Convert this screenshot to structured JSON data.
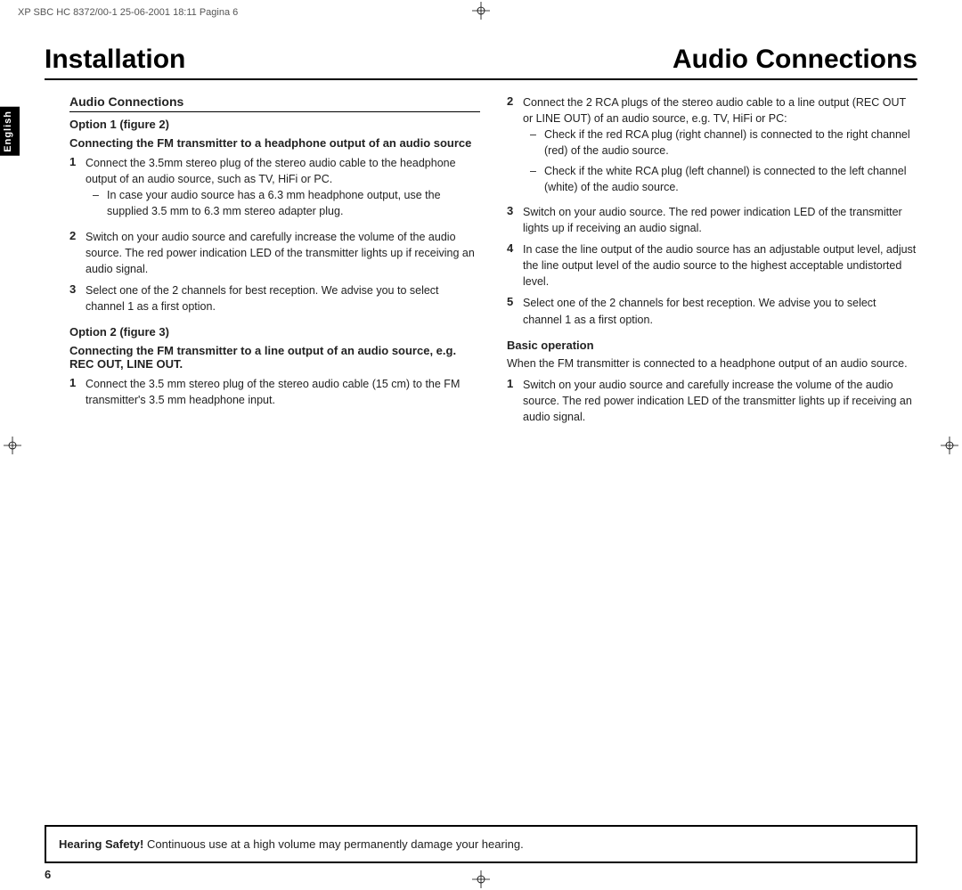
{
  "doc_header": {
    "text": "XP SBC HC 8372/00-1   25-06-2001  18:11   Pagina  6"
  },
  "titles": {
    "installation": "Installation",
    "audio_connections": "Audio Connections"
  },
  "tab": {
    "label": "English"
  },
  "left_column": {
    "section_heading": "Audio Connections",
    "option1_heading": "Option 1 (figure 2)",
    "connecting_heading": "Connecting the FM transmitter to a headphone output of an audio source",
    "items": [
      {
        "num": "1",
        "text": "Connect the 3.5mm stereo plug of the stereo audio cable to the headphone output of an audio source, such as TV, HiFi or PC.",
        "bullets": [
          "In case your audio source has a 6.3 mm headphone output, use the supplied 3.5 mm to 6.3 mm stereo adapter plug."
        ]
      },
      {
        "num": "2",
        "text": "Switch on your audio source and carefully increase the volume of the audio source. The red power indication LED of the transmitter lights up if receiving an audio signal.",
        "bullets": []
      },
      {
        "num": "3",
        "text": "Select one of the 2 channels for best reception. We advise you to select channel 1 as a first option.",
        "bullets": []
      }
    ],
    "option2_heading": "Option 2 (figure 3)",
    "connecting2_heading": "Connecting the FM transmitter to a line output of an audio source, e.g. REC OUT, LINE OUT.",
    "items2": [
      {
        "num": "1",
        "text": "Connect the 3.5 mm stereo plug of the stereo audio cable (15 cm) to the FM transmitter's 3.5 mm headphone input.",
        "bullets": []
      }
    ]
  },
  "right_column": {
    "step2_intro": "2",
    "step2_text": "Connect the 2 RCA plugs of the stereo audio cable to a line output (REC OUT or LINE OUT) of an audio source, e.g. TV, HiFi or PC:",
    "step2_bullets": [
      "Check if the red RCA plug (right channel) is connected to the right channel (red) of the audio source.",
      "Check if the white RCA plug (left channel) is connected to the left channel (white) of the audio source."
    ],
    "step3_num": "3",
    "step3_text": "Switch on your audio source. The red power indication LED of the transmitter lights up if receiving an audio signal.",
    "step4_num": "4",
    "step4_text": "In case the line output of the audio source has an adjustable output level, adjust the line output level of the audio source to the highest acceptable undistorted level.",
    "step5_num": "5",
    "step5_text": "Select one of the 2 channels for best reception. We advise you to select channel 1 as a first option.",
    "basic_op_heading": "Basic operation",
    "basic_op_intro": "When the FM transmitter is connected to a headphone output of an audio source.",
    "basic_items": [
      {
        "num": "1",
        "text": "Switch on your audio source and carefully increase the volume of the audio source. The red power indication LED of the transmitter lights up if receiving an audio signal."
      }
    ]
  },
  "safety": {
    "bold_text": "Hearing Safety!",
    "text": " Continuous use at a high volume may permanently damage your hearing."
  },
  "page_number": "6"
}
